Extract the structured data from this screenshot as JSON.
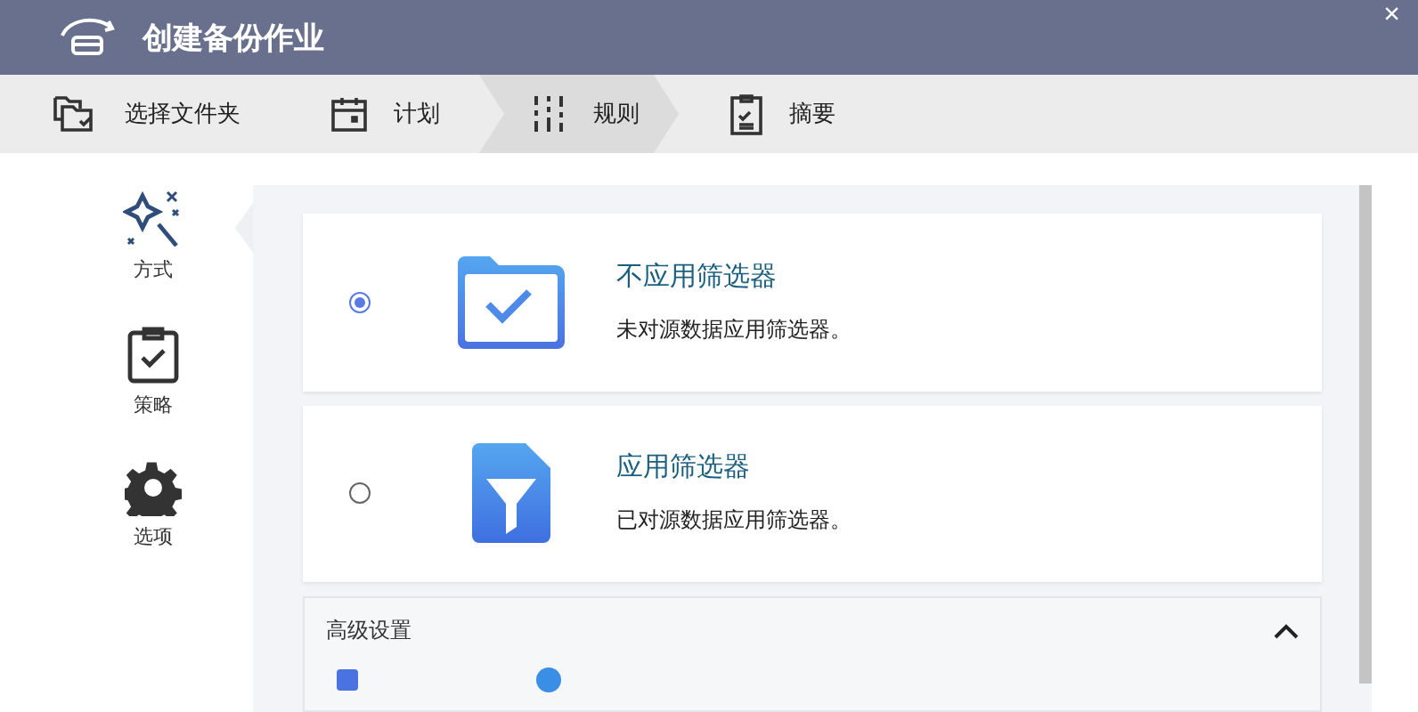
{
  "window": {
    "title": "创建备份作业",
    "close": "×"
  },
  "steps": [
    {
      "label": "选择文件夹",
      "selected": false
    },
    {
      "label": "计划",
      "selected": false
    },
    {
      "label": "规则",
      "selected": true
    },
    {
      "label": "摘要",
      "selected": false
    }
  ],
  "sidebar": {
    "items": [
      {
        "label": "方式",
        "selected": true
      },
      {
        "label": "策略",
        "selected": false
      },
      {
        "label": "选项",
        "selected": false
      }
    ]
  },
  "options": [
    {
      "title": "不应用筛选器",
      "description": "未对源数据应用筛选器。",
      "selected": true
    },
    {
      "title": "应用筛选器",
      "description": "已对源数据应用筛选器。",
      "selected": false
    }
  ],
  "advanced": {
    "title": "高级设置",
    "expanded": true,
    "checkbox_checked": true
  }
}
